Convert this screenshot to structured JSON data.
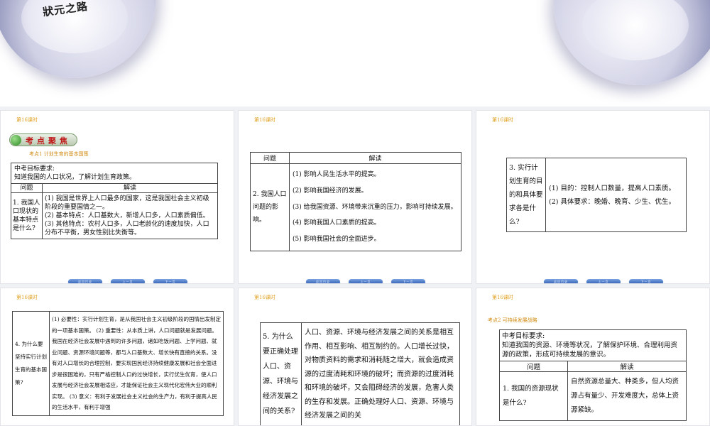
{
  "banner": {
    "logo_text": "狀元之路"
  },
  "slide_tag": "第16课时",
  "nav": [
    "返回目录",
    "上一页",
    "下一页"
  ],
  "slide1": {
    "badge": "考点聚焦",
    "kaodian": "考点1  计划生育的基本国策",
    "goal_title": "中考目标要求:",
    "goal_text": "知道我国的人口状况，了解计划生育政策。",
    "col_q": "问题",
    "col_a": "解读",
    "question": "1. 我国人口现状的基本特点是什么?",
    "answer": [
      "(1) 我国是世界上人口最多的国家，这是我国社会主义初级阶段的重要国情之一。",
      "(2) 基本特点：人口基数大，新增人口多，人口素质偏低。",
      "(3) 其他特点：农村人口多，人口老龄化的速度加快，人口分布不平衡，男女性别比失衡等。"
    ]
  },
  "slide2": {
    "col_q": "问题",
    "col_a": "解读",
    "question": "2. 我国人口问题的影响。",
    "answer": [
      "(1) 影响人民生活水平的提高。",
      "(2) 影响我国经济的发展。",
      "(3) 给我国资源、环境带来沉重的压力，影响可持续发展。",
      "(4) 影响我国人口素质的提高。",
      "(5) 影响我国社会的全面进步。"
    ]
  },
  "slide3": {
    "question": "3. 实行计划生育的目的和具体要求各是什么?",
    "answer": "(1) 目的：控制人口数量，提高人口素质。 (2) 具体要求：晚婚、晚育、少生、优生。"
  },
  "slide4": {
    "question": "4. 为什么要坚持实行计划生育的基本国策?",
    "answer": "(1) 必要性：实行计划生育，是从我国社会主义初级阶段的国情出发制定的一项基本国策。 (2) 重要性：从本质上讲，人口问题就是发展问题。我国在经济社会发展中遇到的许多问题，诸如吃饭问题、上学问题、就业问题、资源环境问题等，都与人口基数大、增长快有直接的关系。没有对人口增长的合理控制，要实现国民经济持续健康发展和社会全面进步是很困难的，只有严格控制人口的过快增长，实行优生优育，使人口发展与经济社会发展相适应，才能保证社会主义现代化宏伟大业的顺利实现。 (3) 意义：有利于发展社会主义社会的生产力，有利于提高人民的生活水平，有利于增强"
  },
  "slide5": {
    "question": "5. 为什么要正确处理人口、资源、环境与经济发展之间的关系?",
    "answer": "人口、资源、环境与经济发展之间的关系是相互作用、相互影响、相互制约的。人口增长过快，对物质资料的需求和消耗随之增大，就会造成资源的过度消耗和环境的破坏；而资源的过度消耗和环境的破坏，又会阻碍经济的发展，危害人类的生存和发展。正确处理好人口、资源、环境与经济发展之间的关"
  },
  "slide6": {
    "kaodian": "考点2  可持续发展战略",
    "goal_title": "中考目标要求:",
    "goal_text": "知道我国的资源、环境等状况，了解保护环境、合理利用资源的政策，形成可持续发展的意识。",
    "col_q": "问题",
    "col_a": "解读",
    "question": "1. 我国的资源现状是什么?",
    "answer": "自然资源总量大、种类多，但人均资源占有量少、开发难度大，总体上资源紧缺。"
  }
}
